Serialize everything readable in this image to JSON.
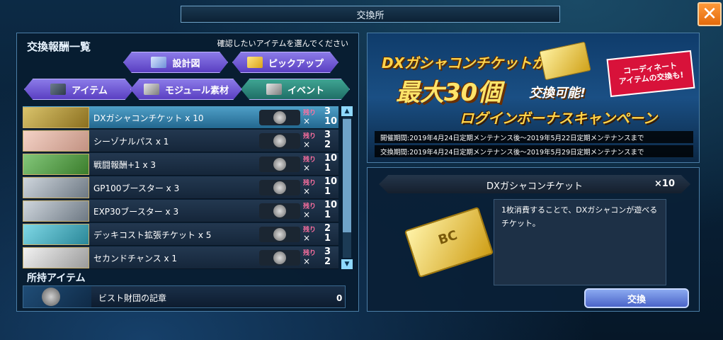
{
  "window": {
    "title": "交換所",
    "close_label": "✕"
  },
  "reward_list": {
    "title": "交換報酬一覧",
    "hint": "確認したいアイテムを選んでください",
    "tabs": [
      {
        "label": "設計図",
        "icon": "blueprint-icon",
        "active": false
      },
      {
        "label": "ピックアップ",
        "icon": "ticket-icon",
        "active": false
      },
      {
        "label": "アイテム",
        "icon": "mech-icon",
        "active": false
      },
      {
        "label": "モジュール素材",
        "icon": "module-icon",
        "active": false
      },
      {
        "label": "イベント",
        "icon": "event-icon",
        "active": true
      }
    ],
    "remain_label": "残り",
    "x_label": "×",
    "items": [
      {
        "name": "DXガシャコンチケット x 10",
        "remain": "3",
        "cost": "10",
        "selected": true
      },
      {
        "name": "シーゾナルパス x 1",
        "remain": "3",
        "cost": "2",
        "selected": false
      },
      {
        "name": "戦闘報酬+1 x 3",
        "remain": "10",
        "cost": "1",
        "selected": false
      },
      {
        "name": "GP100ブースター x 3",
        "remain": "10",
        "cost": "1",
        "selected": false
      },
      {
        "name": "EXP30ブースター x 3",
        "remain": "10",
        "cost": "1",
        "selected": false
      },
      {
        "name": "デッキコスト拡張チケット x 5",
        "remain": "2",
        "cost": "1",
        "selected": false
      },
      {
        "name": "セカンドチャンス x 1",
        "remain": "3",
        "cost": "2",
        "selected": false
      }
    ],
    "scroll_up": "▲",
    "scroll_down": "▼"
  },
  "owned": {
    "title": "所持アイテム",
    "name": "ビスト財団の記章",
    "count": "0"
  },
  "banner": {
    "line1": "DXガシャコンチケットが",
    "big": "最大30個",
    "big_suffix": "交換可能!",
    "sub": "ログインボーナスキャンペーン",
    "badge_line1": "コーディネート",
    "badge_line2": "アイテムの交換も!",
    "period1": "開催期間:2019年4月24日定期メンテナンス後～2019年5月22日定期メンテナンスまで",
    "period2": "交換期間:2019年4月24日定期メンテナンス後～2019年5月29日定期メンテナンスまで"
  },
  "detail": {
    "name": "DXガシャコンチケット",
    "qty": "×10",
    "description": "1枚消費することで、DXガシャコンが遊べるチケット。",
    "exchange_label": "交換"
  },
  "colors": {
    "accent_orange": "#e36a0c",
    "tab_purple": "#5a3fc2",
    "tab_active_teal": "#1f6e66",
    "remain_pink": "#ff6fa0",
    "selected_row": "#23678f"
  }
}
